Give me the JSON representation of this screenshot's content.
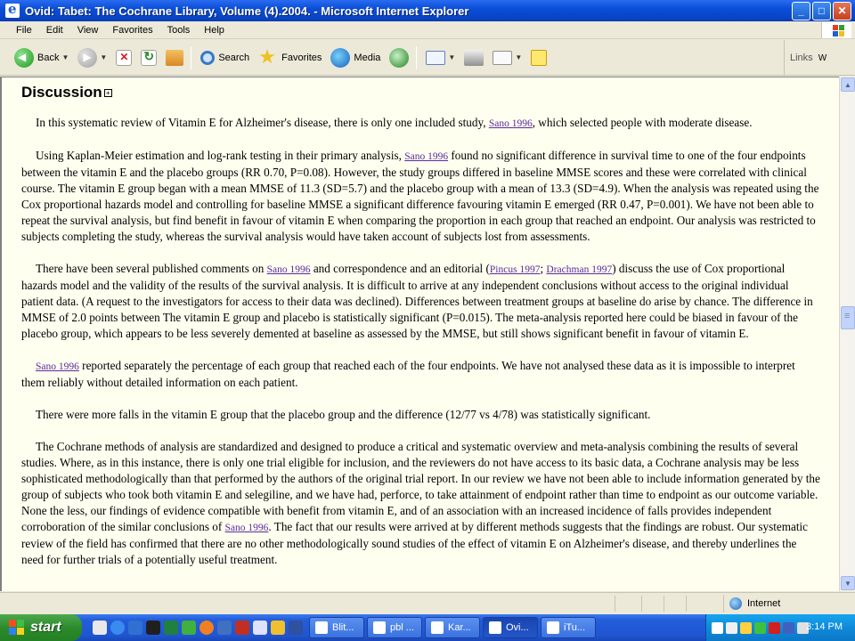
{
  "window": {
    "title": "Ovid: Tabet: The Cochrane Library, Volume (4).2004. - Microsoft Internet Explorer",
    "minimize": "_",
    "maximize": "□",
    "close": "✕"
  },
  "menu": [
    "File",
    "Edit",
    "View",
    "Favorites",
    "Tools",
    "Help"
  ],
  "toolbar": {
    "back_label": "Back",
    "search_label": "Search",
    "favorites_label": "Favorites",
    "media_label": "Media",
    "links_label": "Links"
  },
  "document": {
    "heading": "Discussion",
    "paragraphs": [
      [
        {
          "t": "In this systematic review of Vitamin E for Alzheimer's disease, there is only one included study, "
        },
        {
          "link": "Sano 1996"
        },
        {
          "t": ", which selected people with moderate disease."
        }
      ],
      [
        {
          "t": "Using Kaplan-Meier estimation and log-rank testing in their primary analysis, "
        },
        {
          "link": "Sano 1996"
        },
        {
          "t": " found no significant difference in survival time to one of the four endpoints between the vitamin E and the placebo groups (RR 0.70, P=0.08). However, the study groups differed in baseline MMSE scores and these were correlated with clinical course. The vitamin E group began with a mean MMSE of 11.3 (SD=5.7) and the placebo group with a mean of 13.3 (SD=4.9). When the analysis was repeated using the Cox proportional hazards model and controlling for baseline MMSE a significant difference favouring vitamin E emerged (RR 0.47, P=0.001). We have not been able to repeat the survival analysis, but find benefit in favour of vitamin E when comparing the proportion in each group that reached an endpoint. Our analysis was restricted to subjects completing the study, whereas the survival analysis would have taken account of subjects lost from assessments."
        }
      ],
      [
        {
          "t": "There have been several published comments on "
        },
        {
          "link": "Sano 1996"
        },
        {
          "t": " and correspondence and an editorial ("
        },
        {
          "link": "Pincus 1997"
        },
        {
          "t": "; "
        },
        {
          "link": "Drachman 1997"
        },
        {
          "t": ") discuss the use of Cox proportional hazards model and the validity of the results of the survival analysis. It is difficult to arrive at any independent conclusions without access to the original individual patient data. (A request to the investigators for access to their data was declined). Differences between treatment groups at baseline do arise by chance. The difference in MMSE of 2.0 points between The vitamin E group and placebo is statistically significant (P=0.015). The meta-analysis reported here could be biased in favour of the placebo group, which appears to be less severely demented at baseline as assessed by the MMSE, but still shows significant benefit in favour of vitamin E."
        }
      ],
      [
        {
          "link": "Sano 1996"
        },
        {
          "t": " reported separately the percentage of each group that reached each of the four endpoints. We have not analysed these data as it is impossible to interpret them reliably without detailed information on each patient."
        }
      ],
      [
        {
          "t": "There were more falls in the vitamin E group that the placebo group and the difference (12/77 vs 4/78) was statistically significant."
        }
      ],
      [
        {
          "t": "The Cochrane methods of analysis are standardized and designed to produce a critical and systematic overview and meta-analysis combining the results of several studies. Where, as in this instance, there is only one trial eligible for inclusion, and the reviewers do not have access to its basic data, a Cochrane analysis may be less sophisticated methodologically than that performed by the authors of the original trial report. In our review we have not been able to include information generated by the group of subjects who took both vitamin E and selegiline, and we have had, perforce, to take attainment of endpoint rather than time to endpoint as our outcome variable. None the less, our findings of evidence compatible with benefit from vitamin E, and of an association with an increased incidence of falls provides independent corroboration of the similar conclusions of "
        },
        {
          "link": "Sano 1996"
        },
        {
          "t": ". The fact that our results were arrived at by different methods suggests that the findings are robust. Our systematic review of the field has confirmed that there are no other methodologically sound studies of the effect of vitamin E on Alzheimer's disease, and thereby underlines the need for further trials of a potentially useful treatment."
        }
      ]
    ]
  },
  "statusbar": {
    "zone": "Internet"
  },
  "taskbar": {
    "start_label": "start",
    "tasks": [
      "Blit...",
      "pbl ...",
      "Kar...",
      "Ovi...",
      "iTu..."
    ],
    "active_task": 3,
    "clock": "3:14 PM"
  }
}
